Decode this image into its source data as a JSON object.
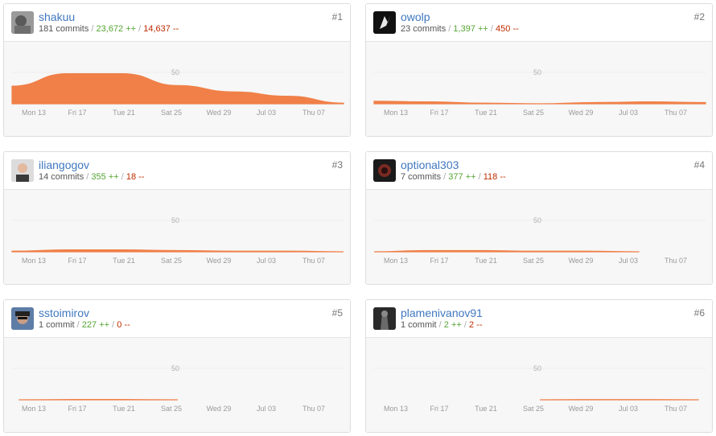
{
  "colors": {
    "username": "#4078c0",
    "additions": "#55a532",
    "deletions": "#bd2c00",
    "area_fill": "#f08048",
    "chart_bg": "#f7f7f7"
  },
  "contributors": [
    {
      "username": "shakuu",
      "commits": "181 commits",
      "additions": "23,672 ++",
      "deletions": "14,637 --",
      "rank": "#1",
      "avatar_icon": "gray-portrait-avatar"
    },
    {
      "username": "owolp",
      "commits": "23 commits",
      "additions": "1,397 ++",
      "deletions": "450 --",
      "rank": "#2",
      "avatar_icon": "dark-sparkle-avatar"
    },
    {
      "username": "iliangogov",
      "commits": "14 commits",
      "additions": "355 ++",
      "deletions": "18 --",
      "rank": "#3",
      "avatar_icon": "bald-man-avatar"
    },
    {
      "username": "optional303",
      "commits": "7 commits",
      "additions": "377 ++",
      "deletions": "118 --",
      "rank": "#4",
      "avatar_icon": "dark-red-avatar"
    },
    {
      "username": "sstoimirov",
      "commits": "1 commit",
      "additions": "227 ++",
      "deletions": "0 --",
      "rank": "#5",
      "avatar_icon": "man-with-cap-avatar"
    },
    {
      "username": "plamenivanov91",
      "commits": "1 commit",
      "additions": "2 ++",
      "deletions": "2 --",
      "rank": "#6",
      "avatar_icon": "dark-figure-avatar"
    }
  ],
  "chart_data": [
    {
      "type": "area",
      "x": [
        "Mon 13",
        "Fri 17",
        "Tue 21",
        "Sat 25",
        "Wed 29",
        "Jul 03",
        "Thu 07"
      ],
      "ytick": "50",
      "ylim": [
        0,
        70
      ],
      "values": [
        28,
        48,
        48,
        29,
        19,
        12,
        1
      ],
      "range": [
        0,
        1
      ]
    },
    {
      "type": "area",
      "x": [
        "Mon 13",
        "Fri 17",
        "Tue 21",
        "Sat 25",
        "Wed 29",
        "Jul 03",
        "Thu 07"
      ],
      "ytick": "50",
      "ylim": [
        0,
        70
      ],
      "values": [
        4,
        3,
        1,
        0,
        2,
        3,
        2
      ],
      "range": [
        0,
        1
      ]
    },
    {
      "type": "area",
      "x": [
        "Mon 13",
        "Fri 17",
        "Tue 21",
        "Sat 25",
        "Wed 29",
        "Jul 03",
        "Thu 07"
      ],
      "ytick": "50",
      "ylim": [
        0,
        70
      ],
      "values": [
        1,
        3,
        3,
        2,
        1,
        1,
        0
      ],
      "range": [
        0,
        1
      ]
    },
    {
      "type": "area",
      "x": [
        "Mon 13",
        "Fri 17",
        "Tue 21",
        "Sat 25",
        "Wed 29",
        "Jul 03",
        "Thu 07"
      ],
      "ytick": "50",
      "ylim": [
        0,
        70
      ],
      "values": [
        0,
        2,
        2,
        1,
        1,
        0
      ],
      "range": [
        0,
        0.8
      ]
    },
    {
      "type": "area",
      "x": [
        "Mon 13",
        "Fri 17",
        "Tue 21",
        "Sat 25",
        "Wed 29",
        "Jul 03",
        "Thu 07"
      ],
      "ytick": "50",
      "ylim": [
        0,
        70
      ],
      "values": [
        0,
        0.5,
        0.5,
        0
      ],
      "range": [
        0.02,
        0.5
      ]
    },
    {
      "type": "area",
      "x": [
        "Mon 13",
        "Fri 17",
        "Tue 21",
        "Sat 25",
        "Wed 29",
        "Jul 03",
        "Thu 07"
      ],
      "ytick": "50",
      "ylim": [
        0,
        70
      ],
      "values": [
        0,
        0.3,
        0.3,
        0.3,
        0
      ],
      "range": [
        0.5,
        0.98
      ]
    }
  ]
}
